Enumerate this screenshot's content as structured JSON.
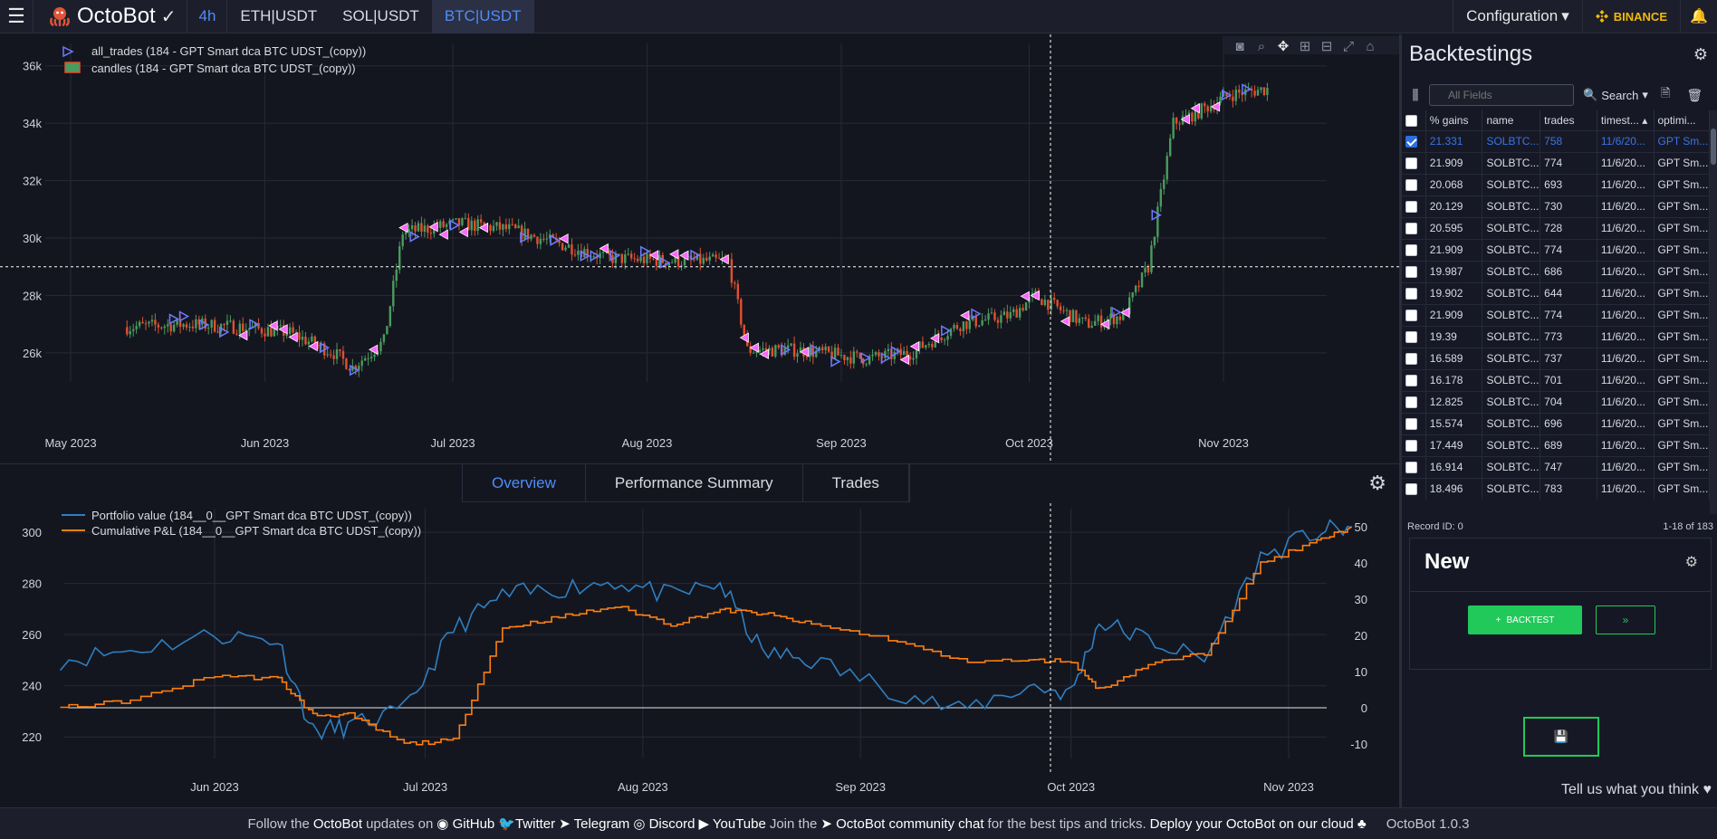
{
  "topbar": {
    "menu_icon": "hamburger-icon",
    "brand": "OctoBot",
    "timeframe": "4h",
    "pairs": [
      "ETH|USDT",
      "SOL|USDT",
      "BTC|USDT"
    ],
    "active_pair": "BTC|USDT",
    "configuration": "Configuration",
    "exchange": "BINANCE",
    "colors": {
      "accent": "#4f8df8",
      "binance": "#f0b90b"
    }
  },
  "chart_data": [
    {
      "type": "candlestick",
      "legend": [
        "all_trades (184 - GPT Smart dca BTC UDST_(copy))",
        "candles (184 - GPT Smart dca BTC UDST_(copy))"
      ],
      "x_ticks": [
        "May 2023",
        "Jun 2023",
        "Jul 2023",
        "Aug 2023",
        "Sep 2023",
        "Oct 2023",
        "Nov 2023"
      ],
      "y_ticks": [
        "26k",
        "28k",
        "30k",
        "32k",
        "34k",
        "36k"
      ],
      "ylim": [
        24800,
        36400
      ],
      "x": [
        "2023-05-10",
        "2023-05-20",
        "2023-05-28",
        "2023-06-05",
        "2023-06-12",
        "2023-06-15",
        "2023-06-20",
        "2023-06-23",
        "2023-07-02",
        "2023-07-10",
        "2023-07-18",
        "2023-07-26",
        "2023-08-05",
        "2023-08-14",
        "2023-08-17",
        "2023-08-25",
        "2023-09-05",
        "2023-09-12",
        "2023-09-20",
        "2023-09-28",
        "2023-10-02",
        "2023-10-10",
        "2023-10-16",
        "2023-10-20",
        "2023-10-24",
        "2023-10-28",
        "2023-11-02",
        "2023-11-08"
      ],
      "y": [
        26900,
        27000,
        26900,
        26700,
        26000,
        25500,
        26400,
        30200,
        30500,
        30300,
        29800,
        29300,
        29200,
        29200,
        26100,
        26100,
        25800,
        26000,
        27000,
        27300,
        28000,
        27000,
        27300,
        29000,
        34000,
        34400,
        35000,
        35200
      ],
      "trade_markers": "sell (magenta) and buy (blue) triangles along the price series"
    },
    {
      "type": "line",
      "legend": [
        "Portfolio value (184__0__GPT Smart dca BTC UDST_(copy))",
        "Cumulative P&L (184__0__GPT Smart dca BTC UDST_(copy))"
      ],
      "x_ticks": [
        "Jun 2023",
        "Jul 2023",
        "Aug 2023",
        "Sep 2023",
        "Oct 2023",
        "Nov 2023"
      ],
      "y_left_ticks": [
        "220",
        "240",
        "260",
        "280",
        "300"
      ],
      "y_right_ticks": [
        "-10",
        "0",
        "10",
        "20",
        "30",
        "40",
        "50"
      ],
      "y_left_range": [
        213,
        305
      ],
      "y_right_range": [
        -13,
        52
      ],
      "x": [
        "2023-05-10",
        "2023-05-20",
        "2023-06-01",
        "2023-06-10",
        "2023-06-15",
        "2023-06-20",
        "2023-06-28",
        "2023-07-05",
        "2023-07-12",
        "2023-07-20",
        "2023-07-28",
        "2023-08-05",
        "2023-08-12",
        "2023-08-18",
        "2023-08-25",
        "2023-09-05",
        "2023-09-15",
        "2023-09-25",
        "2023-10-01",
        "2023-10-05",
        "2023-10-12",
        "2023-10-20",
        "2023-10-28",
        "2023-11-05",
        "2023-11-10"
      ],
      "series": [
        {
          "name": "Portfolio value",
          "color": "#2f7fc1",
          "axis": "left",
          "values": [
            250,
            254,
            260,
            258,
            222,
            224,
            230,
            262,
            275,
            278,
            281,
            275,
            280,
            253,
            250,
            239,
            230,
            240,
            237,
            265,
            258,
            250,
            290,
            300,
            302
          ]
        },
        {
          "name": "Cumulative P&L",
          "color": "#ff7f0e",
          "axis": "right",
          "values": [
            0,
            2,
            9,
            8,
            -2,
            -2,
            -10,
            -9,
            22,
            25,
            28,
            23,
            27,
            26,
            23,
            19,
            13,
            13,
            13,
            5,
            12,
            15,
            40,
            46,
            50
          ]
        }
      ]
    }
  ],
  "bottom_tabs": [
    "Overview",
    "Performance Summary",
    "Trades"
  ],
  "active_tab": "Overview",
  "backtestings": {
    "title": "Backtestings",
    "search_placeholder": "All Fields",
    "search_label": "Search",
    "columns": [
      "% gains",
      "name",
      "trades",
      "timest...",
      "optimi..."
    ],
    "rows": [
      {
        "gains": "21.331",
        "name": "SOLBTC...",
        "trades": "758",
        "ts": "11/6/20...",
        "opt": "GPT Sm...",
        "selected": true
      },
      {
        "gains": "21.909",
        "name": "SOLBTC...",
        "trades": "774",
        "ts": "11/6/20...",
        "opt": "GPT Sm..."
      },
      {
        "gains": "20.068",
        "name": "SOLBTC...",
        "trades": "693",
        "ts": "11/6/20...",
        "opt": "GPT Sm..."
      },
      {
        "gains": "20.129",
        "name": "SOLBTC...",
        "trades": "730",
        "ts": "11/6/20...",
        "opt": "GPT Sm..."
      },
      {
        "gains": "20.595",
        "name": "SOLBTC...",
        "trades": "728",
        "ts": "11/6/20...",
        "opt": "GPT Sm..."
      },
      {
        "gains": "21.909",
        "name": "SOLBTC...",
        "trades": "774",
        "ts": "11/6/20...",
        "opt": "GPT Sm..."
      },
      {
        "gains": "19.987",
        "name": "SOLBTC...",
        "trades": "686",
        "ts": "11/6/20...",
        "opt": "GPT Sm..."
      },
      {
        "gains": "19.902",
        "name": "SOLBTC...",
        "trades": "644",
        "ts": "11/6/20...",
        "opt": "GPT Sm..."
      },
      {
        "gains": "21.909",
        "name": "SOLBTC...",
        "trades": "774",
        "ts": "11/6/20...",
        "opt": "GPT Sm..."
      },
      {
        "gains": "19.39",
        "name": "SOLBTC...",
        "trades": "773",
        "ts": "11/6/20...",
        "opt": "GPT Sm..."
      },
      {
        "gains": "16.589",
        "name": "SOLBTC...",
        "trades": "737",
        "ts": "11/6/20...",
        "opt": "GPT Sm..."
      },
      {
        "gains": "16.178",
        "name": "SOLBTC...",
        "trades": "701",
        "ts": "11/6/20...",
        "opt": "GPT Sm..."
      },
      {
        "gains": "12.825",
        "name": "SOLBTC...",
        "trades": "704",
        "ts": "11/6/20...",
        "opt": "GPT Sm..."
      },
      {
        "gains": "15.574",
        "name": "SOLBTC...",
        "trades": "696",
        "ts": "11/6/20...",
        "opt": "GPT Sm..."
      },
      {
        "gains": "17.449",
        "name": "SOLBTC...",
        "trades": "689",
        "ts": "11/6/20...",
        "opt": "GPT Sm..."
      },
      {
        "gains": "16.914",
        "name": "SOLBTC...",
        "trades": "747",
        "ts": "11/6/20...",
        "opt": "GPT Sm..."
      },
      {
        "gains": "18.496",
        "name": "SOLBTC...",
        "trades": "783",
        "ts": "11/6/20...",
        "opt": "GPT Sm..."
      }
    ],
    "record_id": "Record ID: 0",
    "range": "1-18 of 183"
  },
  "new_panel": {
    "title": "New",
    "backtest_label": "BACKTEST",
    "go_label": "»"
  },
  "feedback": "Tell us what you think",
  "footer": {
    "t1": "Follow the",
    "octobot": "OctoBot",
    "t2": "updates on",
    "github": "GitHub",
    "twitter": "Twitter",
    "telegram": "Telegram",
    "discord": "Discord",
    "youtube": "YouTube",
    "t3": "Join the",
    "community": "OctoBot community chat",
    "t4": "for the best tips and tricks.",
    "deploy": "Deploy your OctoBot on our cloud",
    "version": "OctoBot 1.0.3"
  }
}
